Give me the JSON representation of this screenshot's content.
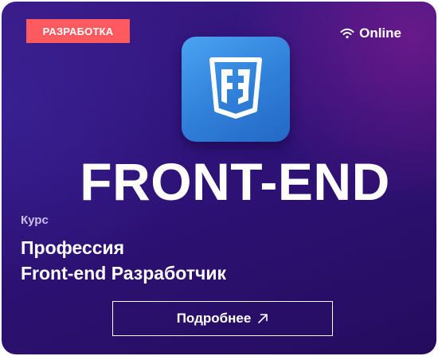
{
  "badge": {
    "label": "РАЗРАБОТКА",
    "color": "#ff5a5f"
  },
  "status": {
    "label": "Online",
    "icon": "wifi-icon"
  },
  "logo": {
    "icon": "html5-shield-icon",
    "tile_color": "#3a8fe6"
  },
  "headline": "FRONT-END",
  "course": {
    "kicker": "Курс",
    "title_line1": "Профессия",
    "title_line2": "Front-end Разработчик"
  },
  "cta": {
    "label": "Подробнее",
    "icon": "arrow-up-right-icon"
  },
  "colors": {
    "background_start": "#3a1a85",
    "background_end": "#250c5e",
    "text": "#ffffff"
  }
}
